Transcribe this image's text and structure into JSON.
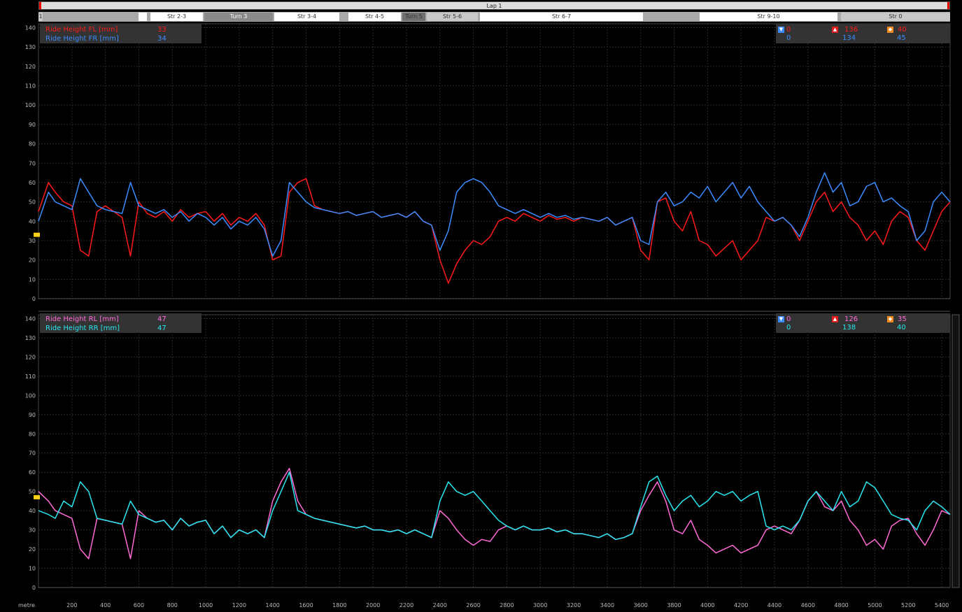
{
  "lap_label": "Lap 1",
  "segments": [
    {
      "label": "1",
      "style": "lo"
    },
    {
      "label": "",
      "style": "hi"
    },
    {
      "label": "Str 2-3",
      "style": "hi"
    },
    {
      "label": "Turn 3",
      "style": "dark"
    },
    {
      "label": "Str 3-4",
      "style": "hi"
    },
    {
      "label": "Str 4-5",
      "style": "hi"
    },
    {
      "label": "Turn 5",
      "style": "m"
    },
    {
      "label": "Str 5-6",
      "style": "lo"
    },
    {
      "label": "Str 6-7",
      "style": "hi"
    },
    {
      "label": "Str 9-10",
      "style": "hi"
    },
    {
      "label": "Str 0",
      "style": "lo"
    }
  ],
  "x_axis_unit": "metre",
  "x_ticks": [
    200,
    400,
    600,
    800,
    1000,
    1200,
    1400,
    1600,
    1800,
    2000,
    2200,
    2400,
    2600,
    2800,
    3000,
    3200,
    3400,
    3600,
    3800,
    4000,
    4200,
    4400,
    4600,
    4800,
    5000,
    5200,
    5400
  ],
  "y_ticks": [
    0,
    10,
    20,
    30,
    40,
    50,
    60,
    70,
    80,
    90,
    100,
    110,
    120,
    130,
    140
  ],
  "colors": {
    "fl": "#ff1a1a",
    "fr": "#3a8cff",
    "rl": "#ff6ad5",
    "rr": "#29e6f0",
    "stat_min": "#3a8cff",
    "stat_max": "#e01e1e",
    "stat_avg": "#f08a1e"
  },
  "front_panel": {
    "legend": [
      {
        "name": "Ride Height FL [mm]",
        "value": "33",
        "color": "#ff1a1a"
      },
      {
        "name": "Ride Height FR [mm]",
        "value": "34",
        "color": "#3a8cff"
      }
    ],
    "stats": [
      {
        "min": "0",
        "max": "136",
        "avg": "40",
        "color": "#ff1a1a"
      },
      {
        "min": "0",
        "max": "134",
        "avg": "45",
        "color": "#3a8cff"
      }
    ]
  },
  "rear_panel": {
    "legend": [
      {
        "name": "Ride Height RL [mm]",
        "value": "47",
        "color": "#ff6ad5"
      },
      {
        "name": "Ride Height RR [mm]",
        "value": "47",
        "color": "#29e6f0"
      }
    ],
    "stats": [
      {
        "min": "0",
        "max": "126",
        "avg": "35",
        "color": "#ff6ad5"
      },
      {
        "min": "0",
        "max": "138",
        "avg": "40",
        "color": "#29e6f0"
      }
    ]
  },
  "chart_data": [
    {
      "type": "line",
      "xlabel": "metre",
      "xlim": [
        0,
        5450
      ],
      "ylim": [
        0,
        142
      ],
      "grid": true,
      "series": [
        {
          "name": "Ride Height FL [mm]",
          "x": [
            0,
            60,
            100,
            150,
            200,
            250,
            300,
            350,
            400,
            450,
            500,
            550,
            600,
            650,
            700,
            750,
            800,
            850,
            900,
            950,
            1000,
            1050,
            1100,
            1150,
            1200,
            1250,
            1300,
            1350,
            1400,
            1450,
            1500,
            1550,
            1600,
            1650,
            1700,
            1750,
            1800,
            1850,
            1900,
            1950,
            2000,
            2050,
            2100,
            2150,
            2200,
            2250,
            2300,
            2350,
            2400,
            2450,
            2500,
            2550,
            2600,
            2650,
            2700,
            2750,
            2800,
            2850,
            2900,
            2950,
            3000,
            3050,
            3100,
            3150,
            3200,
            3250,
            3300,
            3350,
            3400,
            3450,
            3500,
            3550,
            3600,
            3650,
            3700,
            3750,
            3800,
            3850,
            3900,
            3950,
            4000,
            4050,
            4100,
            4150,
            4200,
            4250,
            4300,
            4350,
            4400,
            4450,
            4500,
            4550,
            4600,
            4650,
            4700,
            4750,
            4800,
            4850,
            4900,
            4950,
            5000,
            5050,
            5100,
            5150,
            5200,
            5250,
            5300,
            5350,
            5400,
            5450
          ],
          "y": [
            45,
            60,
            55,
            50,
            48,
            25,
            22,
            45,
            48,
            45,
            42,
            22,
            50,
            44,
            42,
            45,
            40,
            46,
            42,
            44,
            45,
            40,
            44,
            38,
            42,
            40,
            44,
            38,
            20,
            22,
            55,
            60,
            62,
            48,
            46,
            45,
            44,
            45,
            43,
            44,
            45,
            42,
            43,
            44,
            42,
            45,
            40,
            38,
            20,
            8,
            18,
            25,
            30,
            28,
            32,
            40,
            42,
            40,
            44,
            42,
            40,
            43,
            41,
            42,
            40,
            42,
            41,
            40,
            42,
            38,
            40,
            42,
            25,
            20,
            50,
            52,
            40,
            35,
            45,
            30,
            28,
            22,
            26,
            30,
            20,
            25,
            30,
            42,
            40,
            42,
            38,
            30,
            40,
            50,
            55,
            45,
            50,
            42,
            38,
            30,
            35,
            28,
            40,
            45,
            42,
            30,
            25,
            35,
            45,
            50
          ]
        },
        {
          "name": "Ride Height FR [mm]",
          "x": [
            0,
            60,
            100,
            150,
            200,
            250,
            300,
            350,
            400,
            450,
            500,
            550,
            600,
            650,
            700,
            750,
            800,
            850,
            900,
            950,
            1000,
            1050,
            1100,
            1150,
            1200,
            1250,
            1300,
            1350,
            1400,
            1450,
            1500,
            1550,
            1600,
            1650,
            1700,
            1750,
            1800,
            1850,
            1900,
            1950,
            2000,
            2050,
            2100,
            2150,
            2200,
            2250,
            2300,
            2350,
            2400,
            2450,
            2500,
            2550,
            2600,
            2650,
            2700,
            2750,
            2800,
            2850,
            2900,
            2950,
            3000,
            3050,
            3100,
            3150,
            3200,
            3250,
            3300,
            3350,
            3400,
            3450,
            3500,
            3550,
            3600,
            3650,
            3700,
            3750,
            3800,
            3850,
            3900,
            3950,
            4000,
            4050,
            4100,
            4150,
            4200,
            4250,
            4300,
            4350,
            4400,
            4450,
            4500,
            4550,
            4600,
            4650,
            4700,
            4750,
            4800,
            4850,
            4900,
            4950,
            5000,
            5050,
            5100,
            5150,
            5200,
            5250,
            5300,
            5350,
            5400,
            5450
          ],
          "y": [
            40,
            55,
            50,
            48,
            46,
            62,
            55,
            48,
            46,
            45,
            44,
            60,
            48,
            46,
            44,
            46,
            42,
            45,
            40,
            44,
            42,
            38,
            42,
            36,
            40,
            38,
            42,
            36,
            22,
            30,
            60,
            55,
            50,
            47,
            46,
            45,
            44,
            45,
            43,
            44,
            45,
            42,
            43,
            44,
            42,
            45,
            40,
            38,
            25,
            35,
            55,
            60,
            62,
            60,
            55,
            48,
            46,
            44,
            46,
            44,
            42,
            44,
            42,
            43,
            41,
            42,
            41,
            40,
            42,
            38,
            40,
            42,
            30,
            28,
            50,
            55,
            48,
            50,
            55,
            52,
            58,
            50,
            55,
            60,
            52,
            58,
            50,
            45,
            40,
            42,
            38,
            32,
            42,
            55,
            65,
            55,
            60,
            48,
            50,
            58,
            60,
            50,
            52,
            48,
            45,
            30,
            35,
            50,
            55,
            50
          ]
        }
      ]
    },
    {
      "type": "line",
      "xlabel": "metre",
      "xlim": [
        0,
        5450
      ],
      "ylim": [
        0,
        142
      ],
      "grid": true,
      "series": [
        {
          "name": "Ride Height RL [mm]",
          "x": [
            0,
            60,
            100,
            150,
            200,
            250,
            300,
            350,
            400,
            450,
            500,
            550,
            600,
            650,
            700,
            750,
            800,
            850,
            900,
            950,
            1000,
            1050,
            1100,
            1150,
            1200,
            1250,
            1300,
            1350,
            1400,
            1450,
            1500,
            1550,
            1600,
            1650,
            1700,
            1750,
            1800,
            1850,
            1900,
            1950,
            2000,
            2050,
            2100,
            2150,
            2200,
            2250,
            2300,
            2350,
            2400,
            2450,
            2500,
            2550,
            2600,
            2650,
            2700,
            2750,
            2800,
            2850,
            2900,
            2950,
            3000,
            3050,
            3100,
            3150,
            3200,
            3250,
            3300,
            3350,
            3400,
            3450,
            3500,
            3550,
            3600,
            3650,
            3700,
            3750,
            3800,
            3850,
            3900,
            3950,
            4000,
            4050,
            4100,
            4150,
            4200,
            4250,
            4300,
            4350,
            4400,
            4450,
            4500,
            4550,
            4600,
            4650,
            4700,
            4750,
            4800,
            4850,
            4900,
            4950,
            5000,
            5050,
            5100,
            5150,
            5200,
            5250,
            5300,
            5350,
            5400,
            5450
          ],
          "y": [
            50,
            45,
            40,
            38,
            36,
            20,
            15,
            36,
            35,
            34,
            33,
            15,
            40,
            36,
            34,
            35,
            30,
            36,
            32,
            34,
            35,
            28,
            32,
            26,
            30,
            28,
            30,
            26,
            45,
            55,
            62,
            45,
            38,
            36,
            35,
            34,
            33,
            32,
            31,
            32,
            30,
            30,
            29,
            30,
            28,
            30,
            28,
            26,
            40,
            36,
            30,
            25,
            22,
            25,
            24,
            30,
            32,
            30,
            32,
            30,
            30,
            31,
            29,
            30,
            28,
            28,
            27,
            26,
            28,
            25,
            26,
            28,
            40,
            48,
            55,
            45,
            30,
            28,
            35,
            25,
            22,
            18,
            20,
            22,
            18,
            20,
            22,
            30,
            32,
            30,
            28,
            35,
            45,
            50,
            42,
            40,
            45,
            35,
            30,
            22,
            25,
            20,
            32,
            35,
            36,
            28,
            22,
            30,
            40,
            38
          ]
        },
        {
          "name": "Ride Height RR [mm]",
          "x": [
            0,
            60,
            100,
            150,
            200,
            250,
            300,
            350,
            400,
            450,
            500,
            550,
            600,
            650,
            700,
            750,
            800,
            850,
            900,
            950,
            1000,
            1050,
            1100,
            1150,
            1200,
            1250,
            1300,
            1350,
            1400,
            1450,
            1500,
            1550,
            1600,
            1650,
            1700,
            1750,
            1800,
            1850,
            1900,
            1950,
            2000,
            2050,
            2100,
            2150,
            2200,
            2250,
            2300,
            2350,
            2400,
            2450,
            2500,
            2550,
            2600,
            2650,
            2700,
            2750,
            2800,
            2850,
            2900,
            2950,
            3000,
            3050,
            3100,
            3150,
            3200,
            3250,
            3300,
            3350,
            3400,
            3450,
            3500,
            3550,
            3600,
            3650,
            3700,
            3750,
            3800,
            3850,
            3900,
            3950,
            4000,
            4050,
            4100,
            4150,
            4200,
            4250,
            4300,
            4350,
            4400,
            4450,
            4500,
            4550,
            4600,
            4650,
            4700,
            4750,
            4800,
            4850,
            4900,
            4950,
            5000,
            5050,
            5100,
            5150,
            5200,
            5250,
            5300,
            5350,
            5400,
            5450
          ],
          "y": [
            40,
            38,
            36,
            45,
            42,
            55,
            50,
            36,
            35,
            34,
            33,
            45,
            38,
            36,
            34,
            35,
            30,
            36,
            32,
            34,
            35,
            28,
            32,
            26,
            30,
            28,
            30,
            26,
            40,
            50,
            60,
            40,
            38,
            36,
            35,
            34,
            33,
            32,
            31,
            32,
            30,
            30,
            29,
            30,
            28,
            30,
            28,
            26,
            45,
            55,
            50,
            48,
            50,
            45,
            40,
            35,
            32,
            30,
            32,
            30,
            30,
            31,
            29,
            30,
            28,
            28,
            27,
            26,
            28,
            25,
            26,
            28,
            42,
            55,
            58,
            48,
            40,
            45,
            48,
            42,
            45,
            50,
            48,
            50,
            45,
            48,
            50,
            32,
            30,
            32,
            30,
            35,
            45,
            50,
            45,
            40,
            50,
            42,
            45,
            55,
            52,
            45,
            38,
            36,
            35,
            30,
            40,
            45,
            42,
            38
          ]
        }
      ]
    }
  ]
}
